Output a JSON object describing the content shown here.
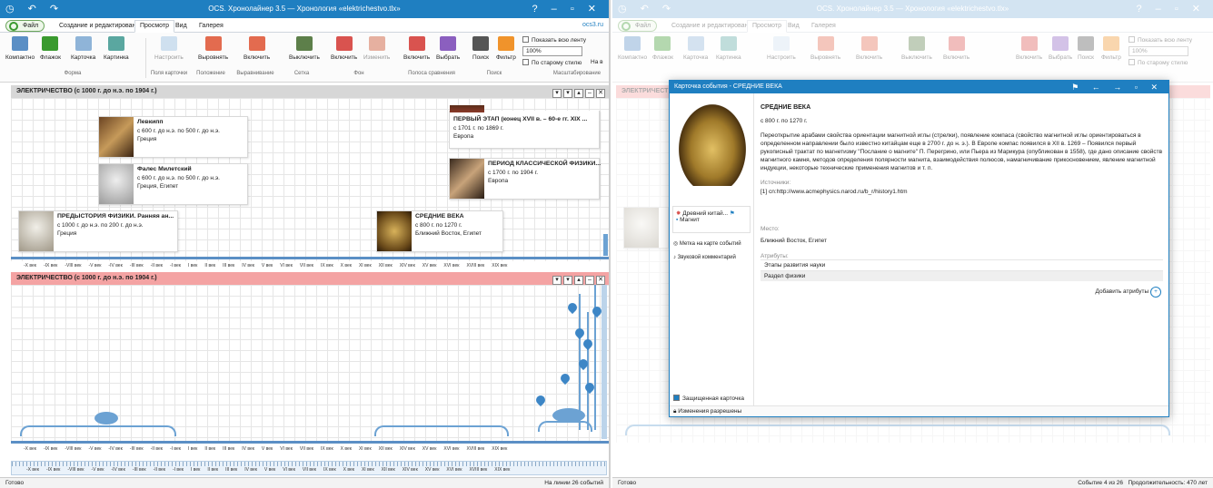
{
  "app": {
    "title": "OCS. Хронолайнер 3.5 — Хронология «elektrichestvo.tlx»",
    "file_tab": "Файл",
    "tabs": [
      "Создание и редактирование",
      "Просмотр",
      "Вид",
      "Галерея"
    ],
    "extra_link": "ocs3.ru"
  },
  "ribbon": {
    "buttons": [
      "Компактно",
      "Флажок",
      "Карточка",
      "Картинка",
      "Настроить",
      "Выровнять",
      "Включить",
      "Выключить",
      "Включить",
      "Изменить",
      "Включить",
      "Выбрать",
      "Поиск",
      "Фильтр"
    ],
    "groups": [
      "Форма",
      "Поля карточки",
      "Положение",
      "Выравнивание",
      "Сетка",
      "Фон",
      "Полоса сравнения",
      "Поиск",
      "Масштабирование"
    ],
    "show_all_label": "Показать всю ленту",
    "zoom_value": "100%",
    "old_style_label": "По старому стилю",
    "on_all_label": "На в"
  },
  "bands": [
    {
      "title": "ЭЛЕКТРИЧЕСТВО (с 1000 г. до н.э. по 1904 г.)"
    },
    {
      "title": "ЭЛЕКТРИЧЕСТВО (с 1000 г. до н.э. по 1904 г.)"
    }
  ],
  "cards": [
    {
      "title": "Левкипп",
      "dates": "с 600 г. до н.э. по 500 г. до н.э.",
      "place": "Греция"
    },
    {
      "title": "Фалес Милетский",
      "dates": "с 600 г. до н.э. по 500 г. до н.э.",
      "place": "Греция, Египет"
    },
    {
      "title": "ПРЕДЫСТОРИЯ ФИЗИКИ. Ранняя ан...",
      "dates": "с 1000 г. до н.э. по 200 г. до н.э.",
      "place": "Греция"
    },
    {
      "title": "СРЕДНИЕ ВЕКА",
      "dates": "с 800 г. по 1270 г.",
      "place": "Ближний Восток, Египет"
    },
    {
      "title": "ПЕРВЫЙ ЭТАП (конец XVII в. – 60-е гг. XIX ...",
      "dates": "с 1701 г. по 1869 г.",
      "place": "Европа"
    },
    {
      "title": "ПЕРИОД КЛАССИЧЕСКОЙ ФИЗИКИ...",
      "dates": "с 1700 г. по 1904 г.",
      "place": "Европа"
    }
  ],
  "axis_ticks": [
    "-X век",
    "-IX век",
    "-VIII век",
    "-V век",
    "-IV век",
    "-III век",
    "-II век",
    "-I век",
    "I век",
    "II век",
    "III век",
    "IV век",
    "V век",
    "VI век",
    "VII век",
    "IX век",
    "X век",
    "XI век",
    "XII век",
    "XIV век",
    "XV век",
    "XVI век",
    "XVIII век",
    "XIX век"
  ],
  "status": {
    "left": "Готово",
    "right": "На линии 26 событий"
  },
  "right_status": {
    "left": "Готово",
    "events": "Событие 4 из 26",
    "duration": "Продолжительность: 470 лет"
  },
  "dialog": {
    "title": "Карточка события - СРЕДНИЕ ВЕКА",
    "heading": "СРЕДНИЕ ВЕКА",
    "dates": "с 800 г. по 1270 г.",
    "description": "Переоткрытие арабами свойства ориентации магнитной иглы (стрелки), появление компаса (свойство магнитной иглы ориентироваться в определенном направлении было известно китайцам еще в 2700 г. до н. э.). В Европе компас появился в XII в. 1269 – Появился первый рукописный трактат по магнетизму \"Послание о магните\" П. Перегрино, или Пьера из Марикура (опубликован в 1558), где дано описание свойств магнитного камня, методов определения полярности магнита, взаимодействия полюсов, намагничивание прикосновением, явление магнитной индукции, некоторые технические применения магнитов и т. п.",
    "sources_label": "Источники:",
    "source": "[1]  cn:http://www.acmephysics.narod.ru/b_r/history1.htm",
    "tags": [
      "Древний китай...",
      "Магнит"
    ],
    "map_mark": "Метка на карте событий",
    "audio": "Звуковой комментарий",
    "place_label": "Место:",
    "place": "Ближний Восток, Египет",
    "attrs_label": "Атрибуты:",
    "attrs": [
      "Этапы развития науки",
      "Раздел физики"
    ],
    "add_attrs": "Добавить атрибуты",
    "protected": "Защищенная карточка",
    "permissions": "Изменения разрешены"
  },
  "colors": {
    "titlebar": "#1f7fc1",
    "band1": "#d7d7d7",
    "band2": "#f4a3a3",
    "pin": "#3d86c6"
  }
}
